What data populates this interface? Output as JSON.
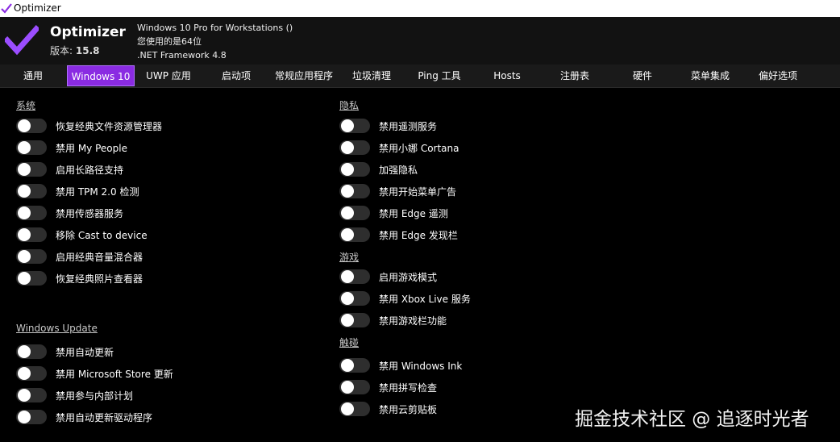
{
  "window": {
    "title": "Optimizer"
  },
  "header": {
    "app_name": "Optimizer",
    "version_label": "版本:",
    "version_value": "15.8",
    "os": "Windows 10 Pro for Workstations ()",
    "arch": "您使用的是64位",
    "framework": ".NET Framework 4.8"
  },
  "tabs": [
    {
      "label": "通用"
    },
    {
      "label": "Windows 10"
    },
    {
      "label": "UWP 应用"
    },
    {
      "label": "启动项"
    },
    {
      "label": "常规应用程序"
    },
    {
      "label": "垃圾清理"
    },
    {
      "label": "Ping 工具"
    },
    {
      "label": "Hosts"
    },
    {
      "label": "注册表"
    },
    {
      "label": "硬件"
    },
    {
      "label": "菜单集成"
    },
    {
      "label": "偏好选项"
    }
  ],
  "active_tab": "Windows 10",
  "sections": {
    "system": {
      "title": "系统",
      "items": [
        "恢复经典文件资源管理器",
        "禁用 My People",
        "启用长路径支持",
        "禁用 TPM 2.0 检测",
        "禁用传感器服务",
        "移除 Cast to device",
        "启用经典音量混合器",
        "恢复经典照片查看器"
      ]
    },
    "update": {
      "title": "Windows Update",
      "items": [
        "禁用自动更新",
        "禁用 Microsoft Store 更新",
        "禁用参与内部计划",
        "禁用自动更新驱动程序"
      ]
    },
    "privacy": {
      "title": "隐私",
      "items": [
        "禁用遥测服务",
        "禁用小娜 Cortana",
        "加强隐私",
        "禁用开始菜单广告",
        "禁用 Edge 遥测",
        "禁用 Edge 发现栏"
      ]
    },
    "gaming": {
      "title": "游戏",
      "items": [
        "启用游戏模式",
        "禁用 Xbox Live 服务",
        "禁用游戏栏功能"
      ]
    },
    "touch": {
      "title": "触碰",
      "items": [
        "禁用 Windows Ink",
        "禁用拼写检查",
        "禁用云剪贴板"
      ]
    }
  },
  "watermark": "掘金技术社区 @ 追逐时光者",
  "colors": {
    "accent": "#8a2be2",
    "background": "#000000",
    "header": "#121212",
    "toggle_off": "#2e2e2e"
  }
}
